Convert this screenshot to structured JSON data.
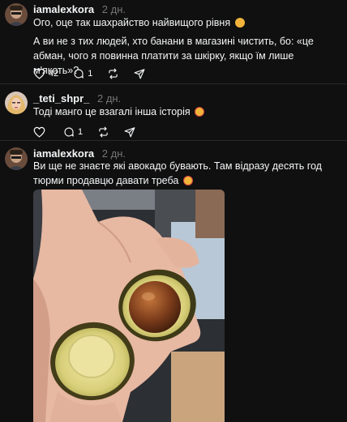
{
  "posts": [
    {
      "username": "iamalexkora",
      "time": "2 дн.",
      "text": "Ого, оце так шахрайство найвищого рівня",
      "emoji": "😩"
    },
    {
      "username": "iamalexkora",
      "time": "2 дн.",
      "text": "А ви не з тих людей, хто банани в магазині чистить, бо: «це абман, чого я повинна платити за шкірку, якщо їм лише м'якоть»?",
      "actions": {
        "likes": "42",
        "replies": "1",
        "reposts": "",
        "shares": ""
      }
    },
    {
      "username": "_teti_shpr_",
      "time": "2 дн.",
      "text": "Тоді манго це взагалі інша історія",
      "emoji": "😂",
      "actions": {
        "likes": "",
        "replies": "1",
        "reposts": "",
        "shares": ""
      }
    },
    {
      "username": "iamalexkora",
      "time": "2 дн.",
      "text": "Ви ще не знаєте які авокадо бувають. Там відразу десять год тюрми продавцю давати треба",
      "emoji": "🤣",
      "image": "photo of a hand holding a cut avocado with pit"
    }
  ],
  "icons": [
    "like-icon",
    "reply-icon",
    "repost-icon",
    "share-icon"
  ]
}
